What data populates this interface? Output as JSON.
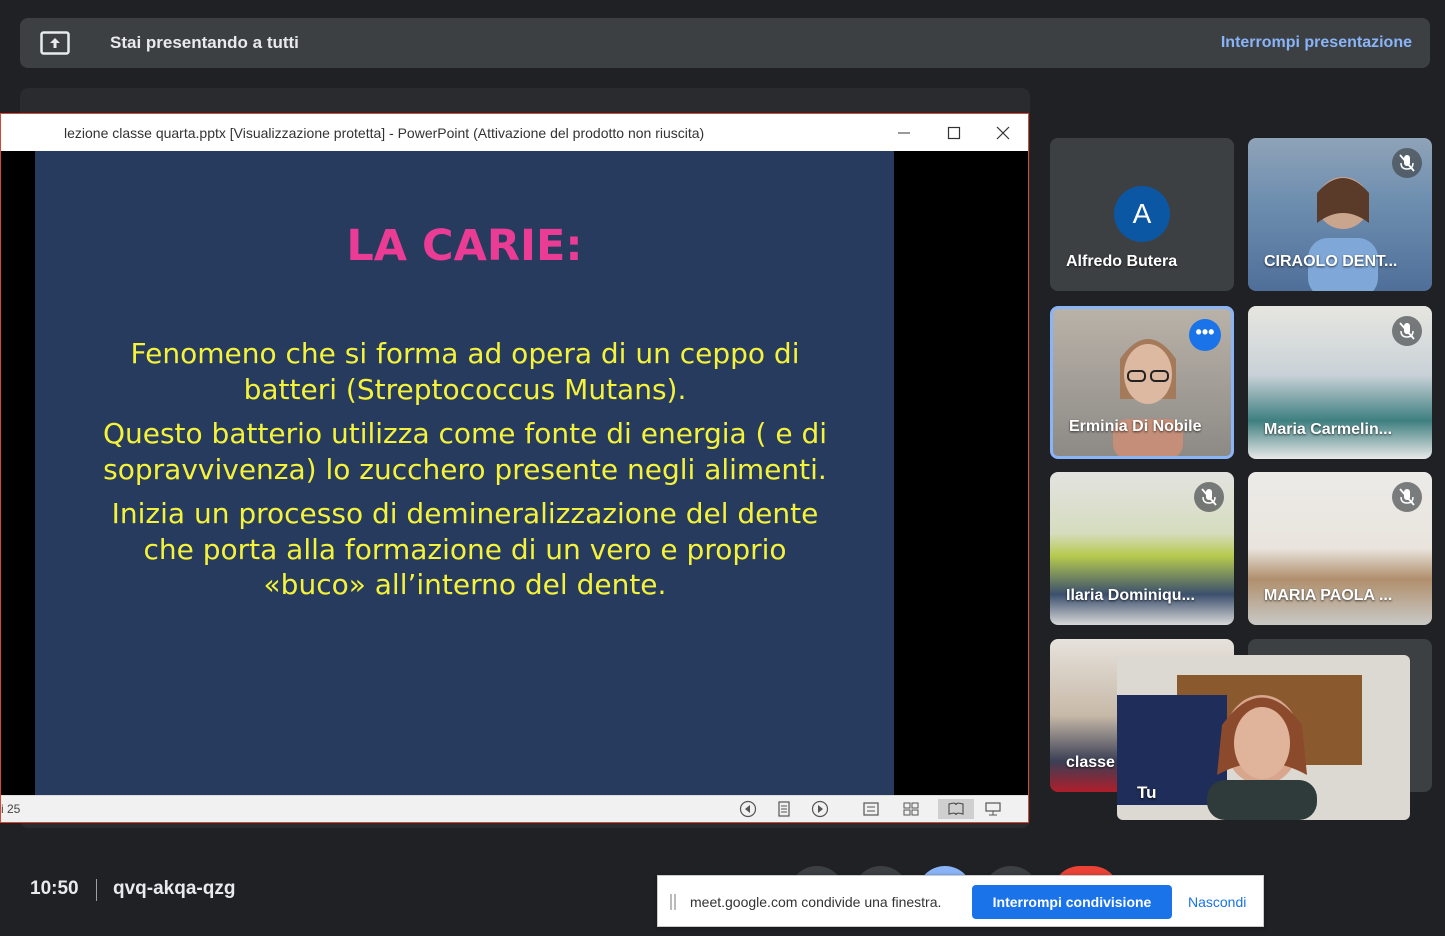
{
  "banner": {
    "text": "Stai presentando a tutti",
    "stop_label": "Interrompi presentazione",
    "icon": "present-to-all-icon"
  },
  "powerpoint": {
    "window_title": "lezione classe quarta.pptx [Visualizzazione protetta] - PowerPoint (Attivazione del prodotto non riuscita)",
    "slide": {
      "title": "LA CARIE:",
      "paragraphs": [
        "Fenomeno che si forma ad opera di un ceppo di batteri (Streptococcus Mutans).",
        "Questo batterio utilizza come fonte di energia ( e di sopravvivenza) lo zucchero presente negli alimenti.",
        "Inizia un processo di demineralizzazione del dente che porta alla formazione di un vero e proprio «buco» all’interno del dente."
      ]
    },
    "status_slide_count": "i 25"
  },
  "participants": [
    {
      "name": "Alfredo Butera",
      "avatar_letter": "A",
      "muted": false
    },
    {
      "name": "CIRAOLO DENT...",
      "muted": true
    },
    {
      "name": "Erminia Di Nobile",
      "muted": false,
      "speaking": true
    },
    {
      "name": "Maria Carmelin...",
      "muted": true
    },
    {
      "name": "Ilaria Dominiqu...",
      "muted": true
    },
    {
      "name": "MARIA PAOLA ...",
      "muted": true
    },
    {
      "name": "classe",
      "muted": false
    }
  ],
  "self_view": {
    "name": "Tu"
  },
  "meeting": {
    "time": "10:50",
    "code": "qvq-akqa-qzg"
  },
  "share_bar": {
    "text": "meet.google.com condivide una finestra.",
    "stop_label": "Interrompi condivisione",
    "hide_label": "Nascondi"
  },
  "colors": {
    "slide_background": "#263b5e",
    "slide_title": "#ea3c95",
    "slide_text": "#f5f23a",
    "accent": "#8ab4f8",
    "primary_button": "#1a73e8"
  }
}
